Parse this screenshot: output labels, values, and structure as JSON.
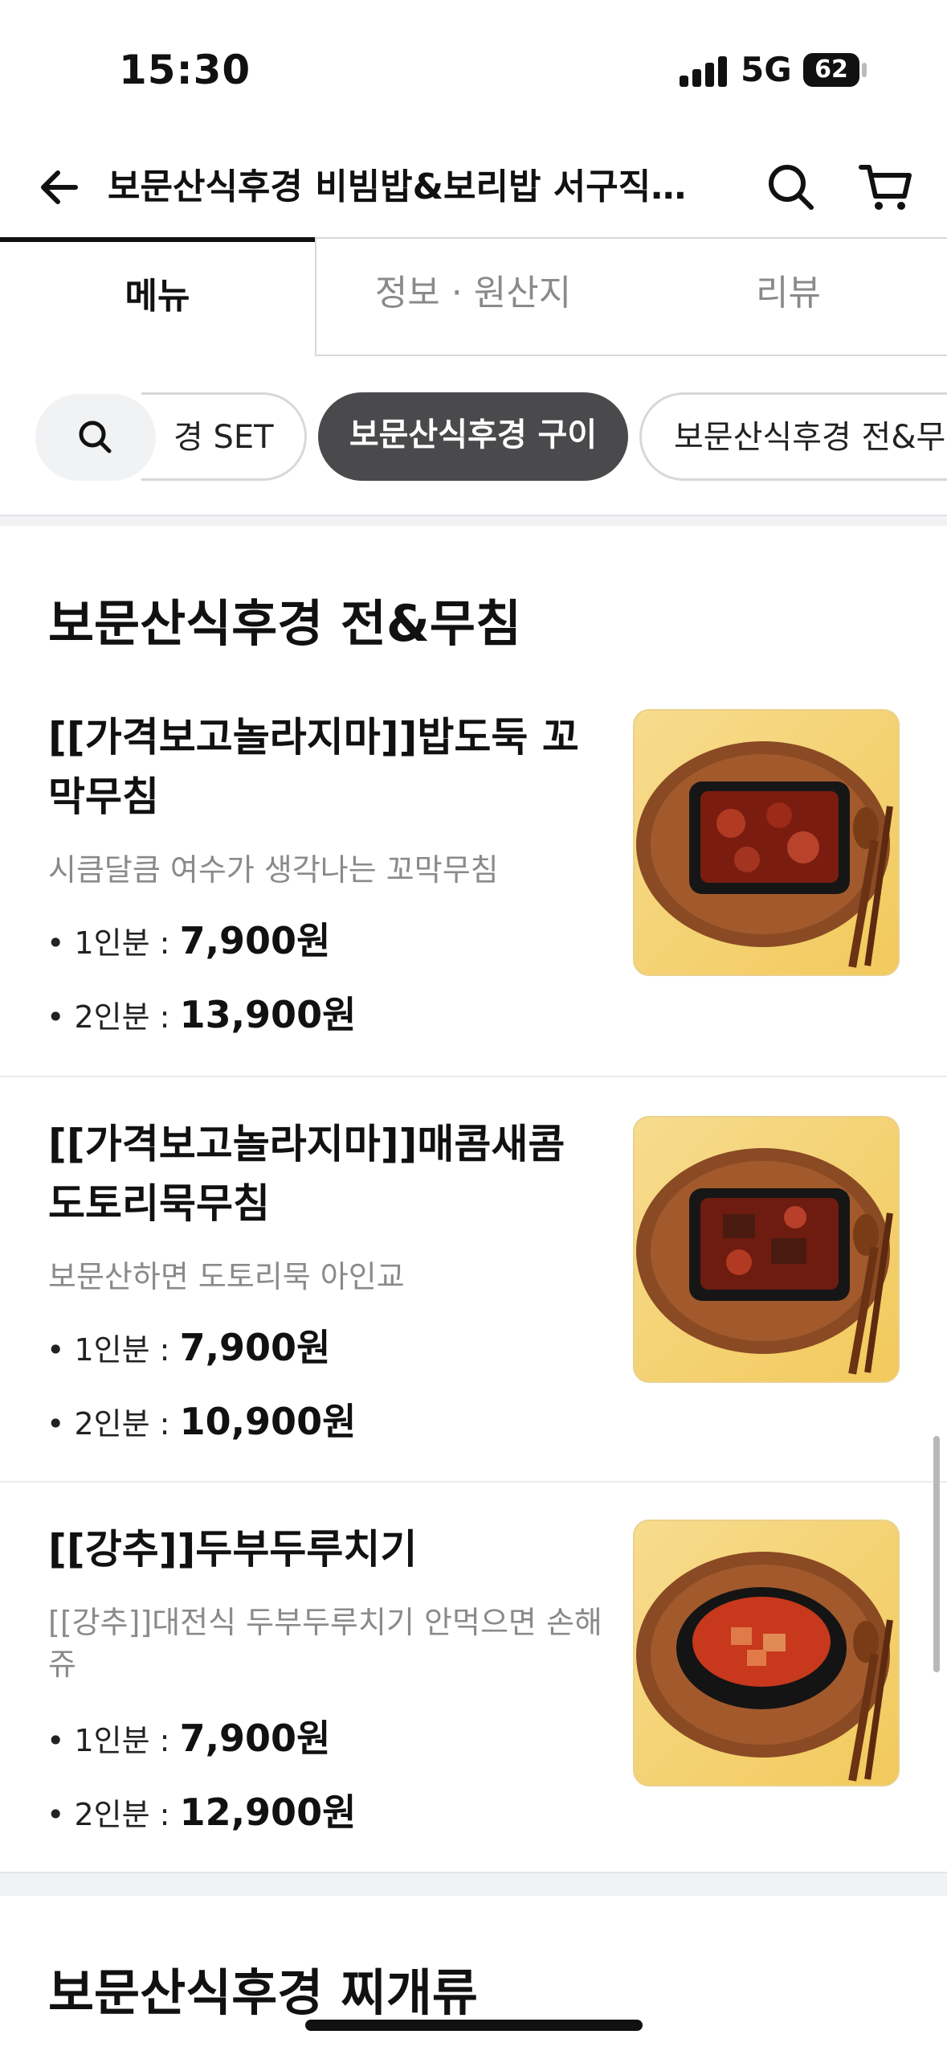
{
  "status": {
    "time": "15:30",
    "network": "5G",
    "battery": "62"
  },
  "header": {
    "title": "보문산식후경 비빔밥&보리밥 서구직…"
  },
  "tabs": [
    {
      "label": "메뉴"
    },
    {
      "label": "정보 · 원산지"
    },
    {
      "label": "리뷰"
    }
  ],
  "chips": [
    {
      "label": "경 SET"
    },
    {
      "label": "보문산식후경 구이"
    },
    {
      "label": "보문산식후경 전&무침"
    }
  ],
  "section": {
    "title": "보문산식후경 전&무침",
    "items": [
      {
        "name": "[[가격보고놀라지마]]밥도둑 꼬막무침",
        "desc": "시큼달큼 여수가 생각나는 꼬막무침",
        "price1_label": "• 1인분 : ",
        "price1": "7,900원",
        "price2_label": "• 2인분 : ",
        "price2": "13,900원"
      },
      {
        "name": "[[가격보고놀라지마]]매콤새콤 도토리묵무침",
        "desc": "보문산하면 도토리묵 아인교",
        "price1_label": "• 1인분 : ",
        "price1": "7,900원",
        "price2_label": "• 2인분 : ",
        "price2": "10,900원"
      },
      {
        "name": "[[강추]]두부두루치기",
        "desc": "[[강추]]대전식 두부두루치기 안먹으면 손해쥬",
        "price1_label": "• 1인분 : ",
        "price1": "7,900원",
        "price2_label": "• 2인분 : ",
        "price2": "12,900원"
      }
    ]
  },
  "next_section": {
    "title": "보문산식후경 찌개류"
  },
  "icons": [
    "back-arrow-icon",
    "search-icon",
    "cart-icon",
    "chip-search-icon"
  ],
  "colors": {
    "active_chip": "#4a4a4c",
    "image_bg": "#f2c95c",
    "muted_text": "#8a8a8a"
  }
}
